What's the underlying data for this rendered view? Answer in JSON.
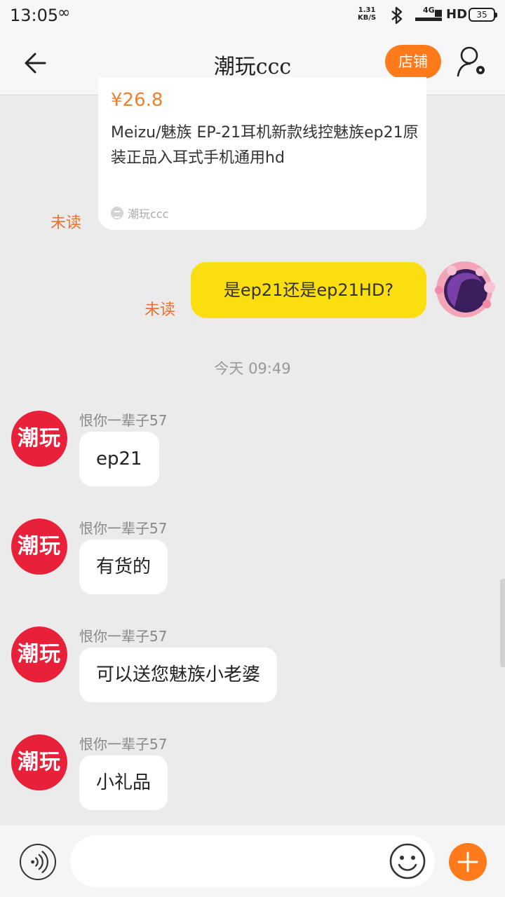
{
  "status_bar": {
    "time": "13:05",
    "infinity_icon": "∞",
    "speed_value": "1.31",
    "speed_unit": "KB/S",
    "network": "4G",
    "hd": "HD",
    "battery": "35"
  },
  "header": {
    "title": "潮玩ccc",
    "shop_button": "店铺"
  },
  "product_card": {
    "price": "¥26.8",
    "title": "Meizu/魅族 EP-21耳机新款线控魅族ep21原装正品入耳式手机通用hd",
    "shop_name": "潮玩ccc",
    "status": "未读"
  },
  "outgoing": {
    "text": "是ep21还是ep21HD?",
    "status": "未读"
  },
  "timestamp": "今天   09:49",
  "messages": [
    {
      "avatar": "潮玩",
      "sender": "恨你一辈子57",
      "text": "ep21"
    },
    {
      "avatar": "潮玩",
      "sender": "恨你一辈子57",
      "text": "有货的"
    },
    {
      "avatar": "潮玩",
      "sender": "恨你一辈子57",
      "text": "可以送您魅族小老婆"
    },
    {
      "avatar": "潮玩",
      "sender": "恨你一辈子57",
      "text": "小礼品"
    }
  ],
  "input_bar": {
    "placeholder": ""
  },
  "colors": {
    "accent_orange": "#ff7a1a",
    "bubble_yellow": "#fbde0f",
    "avatar_red": "#e8203a",
    "unread_orange": "#e8722e"
  },
  "icons": {
    "back": "arrow-left-icon",
    "profile": "person-settings-icon",
    "voice": "voice-wave-icon",
    "emoji": "smiley-icon",
    "plus": "plus-icon"
  }
}
